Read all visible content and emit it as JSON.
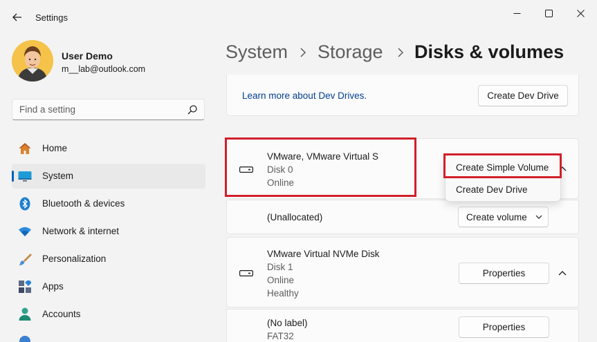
{
  "window": {
    "title": "Settings"
  },
  "profile": {
    "name": "User Demo",
    "email": "m__lab@outlook.com"
  },
  "search": {
    "placeholder": "Find a setting"
  },
  "sidebar": {
    "items": [
      {
        "label": "Home",
        "icon": "home-icon"
      },
      {
        "label": "System",
        "icon": "system-icon",
        "active": true
      },
      {
        "label": "Bluetooth & devices",
        "icon": "bluetooth-icon"
      },
      {
        "label": "Network & internet",
        "icon": "wifi-icon"
      },
      {
        "label": "Personalization",
        "icon": "brush-icon"
      },
      {
        "label": "Apps",
        "icon": "apps-icon"
      },
      {
        "label": "Accounts",
        "icon": "accounts-icon"
      }
    ]
  },
  "breadcrumb": {
    "items": [
      "System",
      "Storage",
      "Disks & volumes"
    ]
  },
  "dev_drive_card": {
    "link": "Learn more about Dev Drives.",
    "button": "Create Dev Drive"
  },
  "disk0": {
    "name": "VMware, VMware Virtual S",
    "number": "Disk 0",
    "status": "Online",
    "volume": {
      "label": "(Unallocated)",
      "button": "Create volume"
    }
  },
  "context_menu": {
    "items": [
      "Create Simple Volume",
      "Create Dev Drive"
    ]
  },
  "disk1": {
    "name": "VMware Virtual NVMe Disk",
    "number": "Disk 1",
    "status": "Online",
    "health": "Healthy",
    "button": "Properties",
    "volume": {
      "label": "(No label)",
      "fs": "FAT32",
      "button": "Properties"
    }
  },
  "colors": {
    "accent": "#005fb8",
    "highlight": "#d21f2a"
  }
}
